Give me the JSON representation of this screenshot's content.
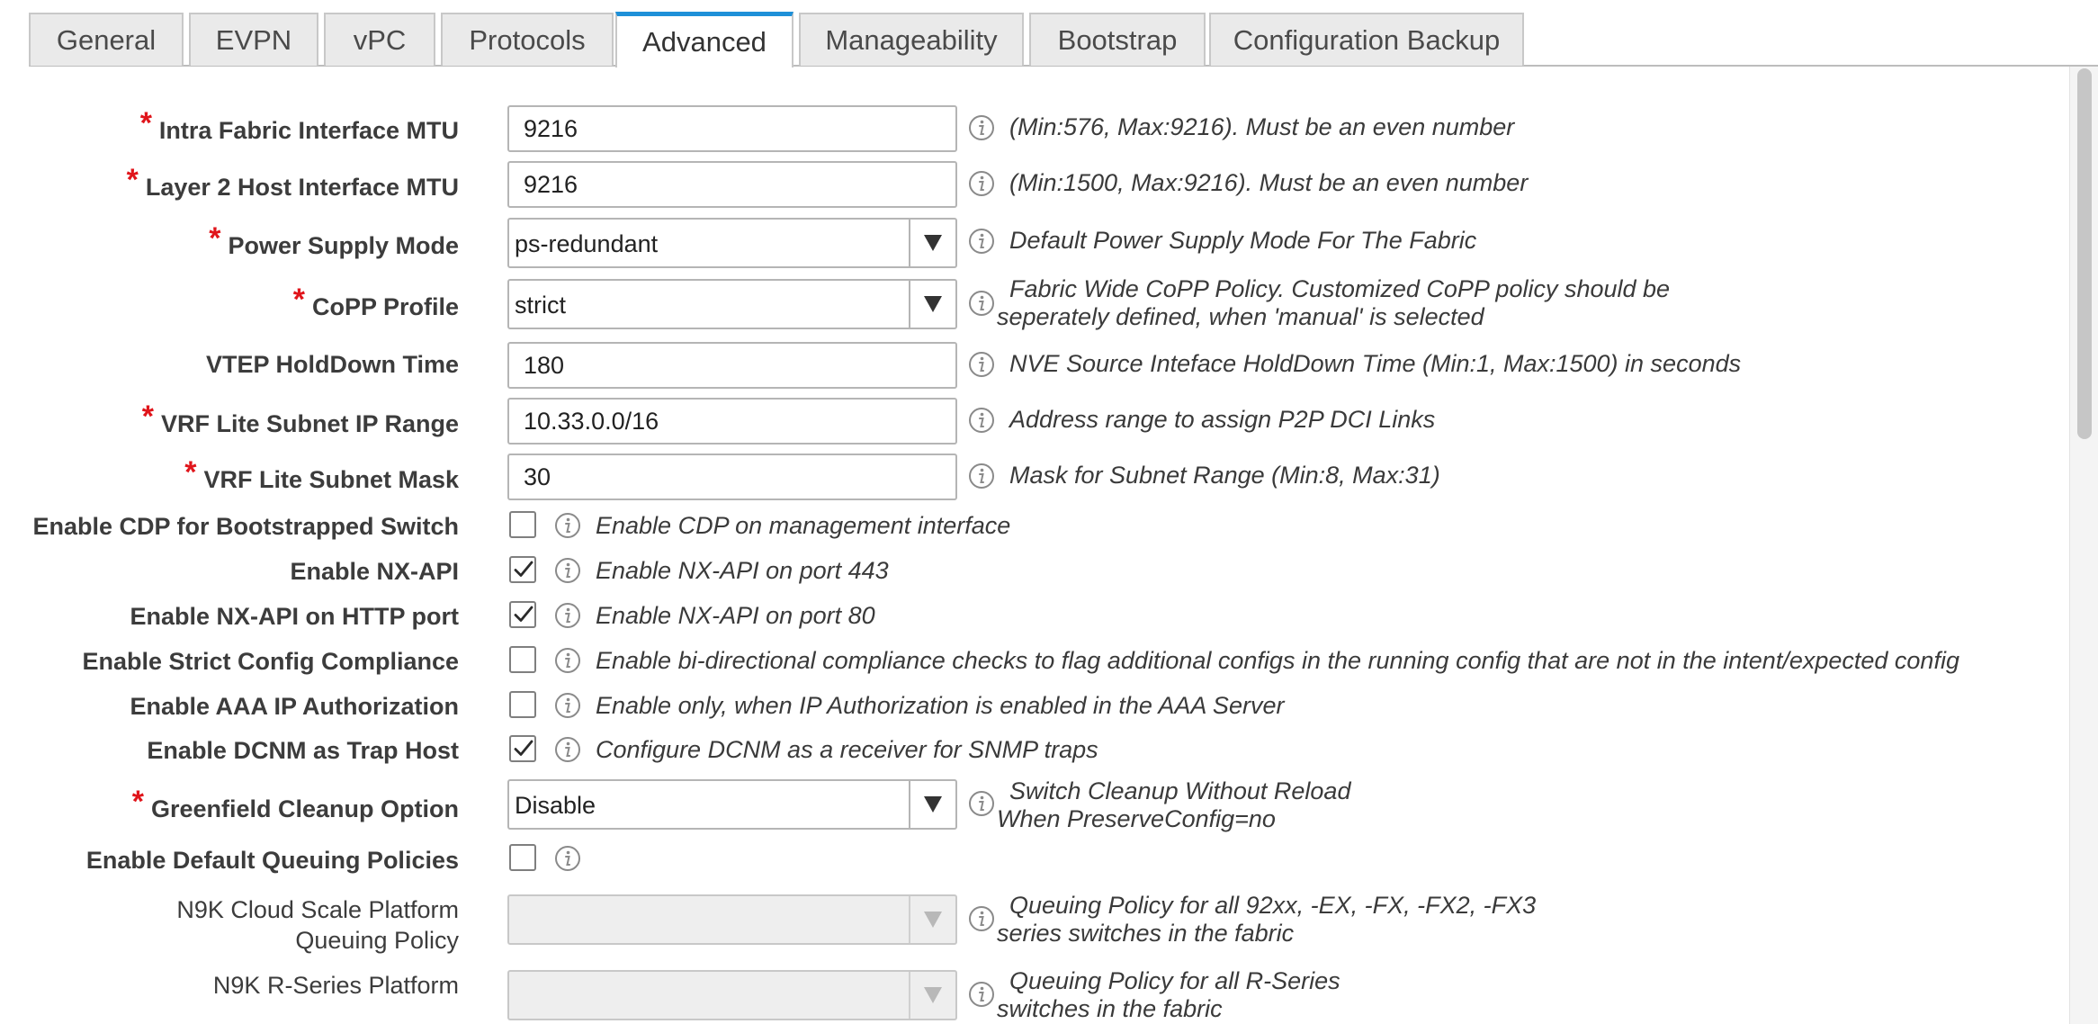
{
  "tabs": [
    {
      "label": "General"
    },
    {
      "label": "EVPN"
    },
    {
      "label": "vPC"
    },
    {
      "label": "Protocols"
    },
    {
      "label": "Advanced",
      "active": true
    },
    {
      "label": "Manageability"
    },
    {
      "label": "Bootstrap"
    },
    {
      "label": "Configuration Backup"
    }
  ],
  "fields": {
    "intra_mtu": {
      "label": "Intra Fabric Interface MTU",
      "required": true,
      "value": "9216",
      "help": "(Min:576, Max:9216). Must be an even number"
    },
    "l2_mtu": {
      "label": "Layer 2 Host Interface MTU",
      "required": true,
      "value": "9216",
      "help": "(Min:1500, Max:9216). Must be an even number"
    },
    "power_supply": {
      "label": "Power Supply Mode",
      "required": true,
      "value": "ps-redundant",
      "help": "Default Power Supply Mode For The Fabric"
    },
    "copp": {
      "label": "CoPP Profile",
      "required": true,
      "value": "strict",
      "help_line1": "Fabric Wide CoPP Policy. Customized CoPP policy should be",
      "help_line2": "seperately defined, when 'manual' is selected"
    },
    "vtep_holddown": {
      "label": "VTEP HoldDown Time",
      "required": false,
      "value": "180",
      "help": "NVE Source Inteface HoldDown Time (Min:1, Max:1500) in seconds"
    },
    "vrf_range": {
      "label": "VRF Lite Subnet IP Range",
      "required": true,
      "value": "10.33.0.0/16",
      "help": "Address range to assign P2P DCI Links"
    },
    "vrf_mask": {
      "label": "VRF Lite Subnet Mask",
      "required": true,
      "value": "30",
      "help": "Mask for Subnet Range (Min:8, Max:31)"
    },
    "cdp": {
      "label": "Enable CDP for Bootstrapped Switch",
      "checked": false,
      "help": "Enable CDP on management interface"
    },
    "nxapi": {
      "label": "Enable NX-API",
      "checked": true,
      "help": "Enable NX-API on port 443"
    },
    "nxapi_http": {
      "label": "Enable NX-API on HTTP port",
      "checked": true,
      "help": "Enable NX-API on port 80"
    },
    "strict_compliance": {
      "label": "Enable Strict Config Compliance",
      "checked": false,
      "help": "Enable bi-directional compliance checks to flag additional configs in the running config that are not in the intent/expected config"
    },
    "aaa_ip": {
      "label": "Enable AAA IP Authorization",
      "checked": false,
      "help": "Enable only, when IP Authorization is enabled in the AAA Server"
    },
    "dcnm_trap": {
      "label": "Enable DCNM as Trap Host",
      "checked": true,
      "help": "Configure DCNM as a receiver for SNMP traps"
    },
    "greenfield": {
      "label": "Greenfield Cleanup Option",
      "required": true,
      "value": "Disable",
      "help_line1": "Switch Cleanup Without Reload",
      "help_line2": "When PreserveConfig=no"
    },
    "queuing": {
      "label": "Enable Default Queuing Policies",
      "checked": false
    },
    "n9k_cloud": {
      "label_line1": "N9K Cloud Scale Platform",
      "label_line2": "Queuing Policy",
      "value": "",
      "help_line1": "Queuing Policy for all 92xx, -EX, -FX, -FX2, -FX3",
      "help_line2": "series switches in the fabric"
    },
    "n9k_r": {
      "label_line1": "N9K R-Series Platform",
      "value": "",
      "help_line1": "Queuing Policy for all R-Series",
      "help_line2": "switches in the fabric"
    }
  },
  "colors": {
    "required": "#e0151b",
    "active_tab": "#1e90d8"
  },
  "icons": {
    "info": "info-circle-icon",
    "dropdown": "triangle-down-icon",
    "check": "checkmark-icon"
  }
}
